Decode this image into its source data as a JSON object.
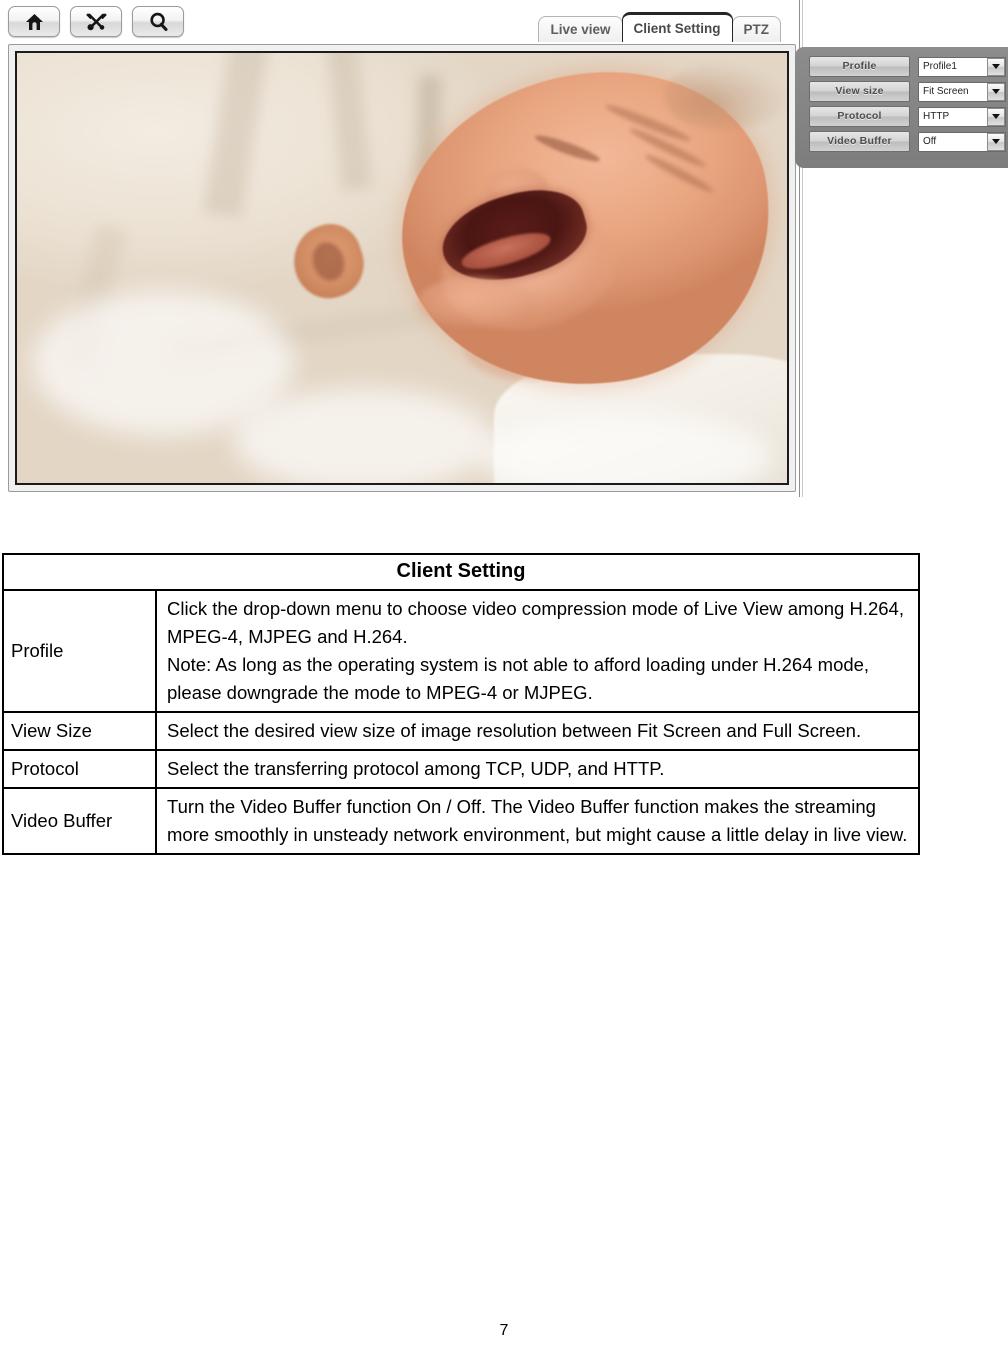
{
  "camera_ui": {
    "toolbar": [
      {
        "name": "home-icon",
        "label": "Home"
      },
      {
        "name": "tools-icon",
        "label": "Setup"
      },
      {
        "name": "search-icon",
        "label": "Search"
      }
    ],
    "tabs": [
      {
        "label": "Live view",
        "active": false
      },
      {
        "label": "Client Setting",
        "active": true
      },
      {
        "label": "PTZ",
        "active": false
      }
    ],
    "video": {
      "alt": "Live view of a crying newborn baby lying on white bedding"
    },
    "settings": [
      {
        "label": "Profile",
        "value": "Profile1"
      },
      {
        "label": "View size",
        "value": "Fit Screen"
      },
      {
        "label": "Protocol",
        "value": "HTTP"
      },
      {
        "label": "Video Buffer",
        "value": "Off"
      }
    ]
  },
  "doc": {
    "table_title": "Client Setting",
    "rows": [
      {
        "term": "Profile",
        "description": "Click the drop-down menu to choose video compression mode of Live View among H.264, MPEG-4, MJPEG and H.264.\nNote: As long as the operating system is not able to afford loading under H.264 mode, please downgrade the mode to MPEG-4 or MJPEG."
      },
      {
        "term": "View Size",
        "description": "Select the desired view size of image resolution between Fit Screen and Full Screen."
      },
      {
        "term": "Protocol",
        "description": "Select the transferring protocol among TCP, UDP, and HTTP."
      },
      {
        "term": "Video Buffer",
        "description": "Turn the Video Buffer function On / Off. The Video Buffer function makes the streaming more smoothly in unsteady network environment, but might cause a little delay in live view."
      }
    ]
  },
  "page_number": "7"
}
